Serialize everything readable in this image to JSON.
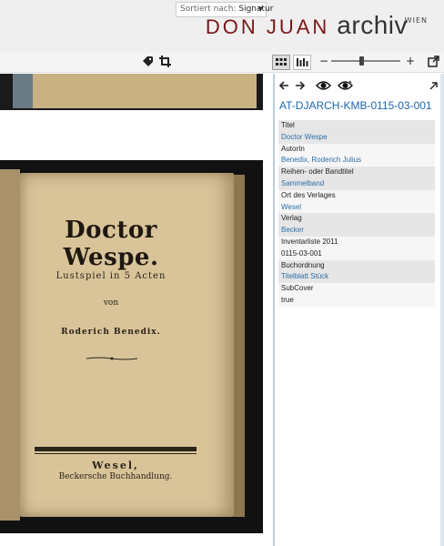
{
  "header": {
    "logo_main": "DON JUAN",
    "logo_archiv": "archiv",
    "logo_city": "WIEN"
  },
  "toolbar": {
    "sort_prefix": "Sortiert nach:",
    "sort_value": "Signatur",
    "zoom_minus": "−",
    "zoom_plus": "+",
    "zoom_level": 0.45
  },
  "document": {
    "title": "Doctor Wespe.",
    "subtitle": "Lustspiel in 5 Acten",
    "by": "von",
    "author": "Roderich Benedix.",
    "place": "Wesel,",
    "publisher": "Beckersche Buchhandlung."
  },
  "panel": {
    "record_id": "AT-DJARCH-KMB-0115-03-001",
    "fields": [
      {
        "label": "Titel",
        "value": "Doctor Wespe",
        "link": true
      },
      {
        "label": "AutorIn",
        "value": "Benedix, Roderich Julius",
        "link": true
      },
      {
        "label": "Reihen- oder Bandtitel",
        "value": "Sammelband",
        "link": true
      },
      {
        "label": "Ort des Verlages",
        "value": "Wesel",
        "link": true
      },
      {
        "label": "Verlag",
        "value": "Becker",
        "link": true
      },
      {
        "label": "Inventarliste 2011",
        "value": "0115-03-001",
        "link": false
      },
      {
        "label": "Buchordnung",
        "value": "Titelblatt Stück",
        "link": true
      },
      {
        "label": "SubCover",
        "value": "true",
        "link": false
      }
    ]
  },
  "colors": {
    "brand_red": "#7a1616",
    "link_blue": "#2b6ea8",
    "panel_border": "#b9cde0"
  }
}
